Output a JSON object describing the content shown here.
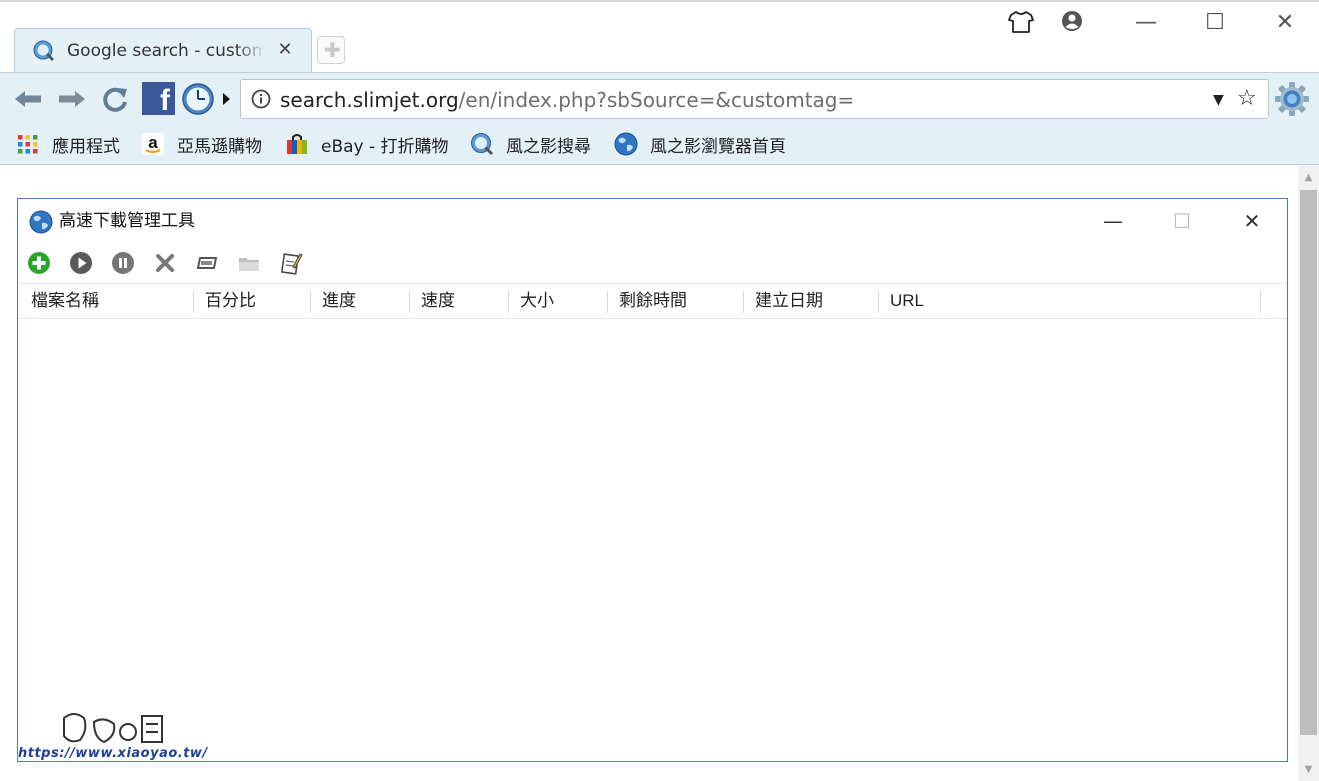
{
  "browser": {
    "tab": {
      "title": "Google search - customtag",
      "close": "✕"
    },
    "window_controls": {
      "minimize": "—",
      "maximize": "☐",
      "close": "✕"
    },
    "address": {
      "host": "search.slimjet.org",
      "path": "/en/index.php?sbSource=&customtag="
    },
    "bookmarks": [
      {
        "label": "應用程式",
        "icon": "apps-grid-icon"
      },
      {
        "label": "亞馬遜購物",
        "icon": "amazon-icon"
      },
      {
        "label": "eBay - 打折購物",
        "icon": "shopping-bag-icon"
      },
      {
        "label": "風之影搜尋",
        "icon": "search-globe-icon"
      },
      {
        "label": "風之影瀏覽器首頁",
        "icon": "globe-icon"
      }
    ]
  },
  "dialog": {
    "title": "高速下載管理工具",
    "toolbar": [
      "add-icon",
      "play-icon",
      "pause-icon",
      "delete-icon",
      "rename-icon",
      "folder-icon",
      "notes-icon"
    ],
    "columns": [
      "檔案名稱",
      "百分比",
      "進度",
      "速度",
      "大小",
      "剩餘時間",
      "建立日期",
      "URL"
    ],
    "rows": []
  },
  "watermark": {
    "text": "https://www.xiaoyao.tw/"
  },
  "colors": {
    "chrome_bg": "#e3f0f6",
    "dialog_border": "#4a7bc8",
    "add_green": "#2aa52a"
  }
}
